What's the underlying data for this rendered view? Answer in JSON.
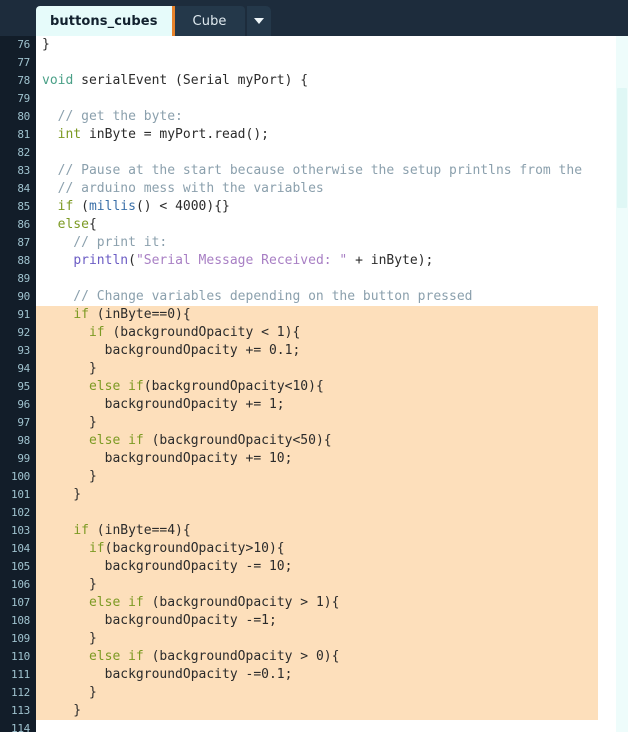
{
  "window": {
    "app": "Processing Code Editor",
    "accent_orange": "#e8832b",
    "tabbar_bg": "#1d2c3c",
    "gutter_bg": "#121d29",
    "selection_bg": "#fddfbb"
  },
  "tabs": {
    "items": [
      {
        "label": "buttons_cubes",
        "active": true
      },
      {
        "label": "Cube",
        "active": false
      }
    ],
    "menu_icon": "chevron-down-icon"
  },
  "editor": {
    "first_line": 76,
    "selection_start_line": 91,
    "selection_end_line": 113,
    "lines": [
      {
        "n": "76",
        "tokens": [
          {
            "t": "pln",
            "v": "}"
          }
        ]
      },
      {
        "n": "77",
        "tokens": []
      },
      {
        "n": "78",
        "tokens": [
          {
            "t": "typ",
            "v": "void"
          },
          {
            "t": "pln",
            "v": " serialEvent (Serial myPort) {"
          }
        ]
      },
      {
        "n": "79",
        "tokens": []
      },
      {
        "n": "80",
        "tokens": [
          {
            "t": "cmt",
            "v": "  // get the byte:"
          }
        ]
      },
      {
        "n": "81",
        "tokens": [
          {
            "t": "pln",
            "v": "  "
          },
          {
            "t": "kw",
            "v": "int"
          },
          {
            "t": "pln",
            "v": " inByte = myPort.read();"
          }
        ]
      },
      {
        "n": "82",
        "tokens": []
      },
      {
        "n": "83",
        "tokens": [
          {
            "t": "cmt",
            "v": "  // Pause at the start because otherwise the setup printlns from the"
          }
        ]
      },
      {
        "n": "84",
        "tokens": [
          {
            "t": "cmt",
            "v": "  // arduino mess with the variables"
          }
        ]
      },
      {
        "n": "85",
        "tokens": [
          {
            "t": "pln",
            "v": "  "
          },
          {
            "t": "kw",
            "v": "if"
          },
          {
            "t": "pln",
            "v": " ("
          },
          {
            "t": "fn",
            "v": "millis"
          },
          {
            "t": "pln",
            "v": "() < 4000){}"
          }
        ]
      },
      {
        "n": "86",
        "tokens": [
          {
            "t": "pln",
            "v": "  "
          },
          {
            "t": "kw",
            "v": "else"
          },
          {
            "t": "pln",
            "v": "{"
          }
        ]
      },
      {
        "n": "87",
        "tokens": [
          {
            "t": "cmt",
            "v": "    // print it:"
          }
        ]
      },
      {
        "n": "88",
        "tokens": [
          {
            "t": "pln",
            "v": "    "
          },
          {
            "t": "mth",
            "v": "println"
          },
          {
            "t": "pln",
            "v": "("
          },
          {
            "t": "str",
            "v": "\"Serial Message Received: \""
          },
          {
            "t": "pln",
            "v": " + inByte);"
          }
        ]
      },
      {
        "n": "89",
        "tokens": []
      },
      {
        "n": "90",
        "tokens": [
          {
            "t": "cmt",
            "v": "    // Change variables depending on the button pressed"
          }
        ]
      },
      {
        "n": "91",
        "tokens": [
          {
            "t": "pln",
            "v": "    "
          },
          {
            "t": "kw",
            "v": "if"
          },
          {
            "t": "pln",
            "v": " (inByte==0){"
          }
        ]
      },
      {
        "n": "92",
        "tokens": [
          {
            "t": "pln",
            "v": "      "
          },
          {
            "t": "kw",
            "v": "if"
          },
          {
            "t": "pln",
            "v": " (backgroundOpacity < 1){"
          }
        ]
      },
      {
        "n": "93",
        "tokens": [
          {
            "t": "pln",
            "v": "        backgroundOpacity += 0.1;"
          }
        ]
      },
      {
        "n": "94",
        "tokens": [
          {
            "t": "pln",
            "v": "      }"
          }
        ]
      },
      {
        "n": "95",
        "tokens": [
          {
            "t": "pln",
            "v": "      "
          },
          {
            "t": "kw",
            "v": "else if"
          },
          {
            "t": "pln",
            "v": "(backgroundOpacity<10){"
          }
        ]
      },
      {
        "n": "96",
        "tokens": [
          {
            "t": "pln",
            "v": "        backgroundOpacity += 1;"
          }
        ]
      },
      {
        "n": "97",
        "tokens": [
          {
            "t": "pln",
            "v": "      }"
          }
        ]
      },
      {
        "n": "98",
        "tokens": [
          {
            "t": "pln",
            "v": "      "
          },
          {
            "t": "kw",
            "v": "else if"
          },
          {
            "t": "pln",
            "v": " (backgroundOpacity<50){"
          }
        ]
      },
      {
        "n": "99",
        "tokens": [
          {
            "t": "pln",
            "v": "        backgroundOpacity += 10;"
          }
        ]
      },
      {
        "n": "100",
        "tokens": [
          {
            "t": "pln",
            "v": "      }"
          }
        ]
      },
      {
        "n": "101",
        "tokens": [
          {
            "t": "pln",
            "v": "    }"
          }
        ]
      },
      {
        "n": "102",
        "tokens": []
      },
      {
        "n": "103",
        "tokens": [
          {
            "t": "pln",
            "v": "    "
          },
          {
            "t": "kw",
            "v": "if"
          },
          {
            "t": "pln",
            "v": " (inByte==4){"
          }
        ]
      },
      {
        "n": "104",
        "tokens": [
          {
            "t": "pln",
            "v": "      "
          },
          {
            "t": "kw",
            "v": "if"
          },
          {
            "t": "pln",
            "v": "(backgroundOpacity>10){"
          }
        ]
      },
      {
        "n": "105",
        "tokens": [
          {
            "t": "pln",
            "v": "        backgroundOpacity -= 10;"
          }
        ]
      },
      {
        "n": "106",
        "tokens": [
          {
            "t": "pln",
            "v": "      }"
          }
        ]
      },
      {
        "n": "107",
        "tokens": [
          {
            "t": "pln",
            "v": "      "
          },
          {
            "t": "kw",
            "v": "else if"
          },
          {
            "t": "pln",
            "v": " (backgroundOpacity > 1){"
          }
        ]
      },
      {
        "n": "108",
        "tokens": [
          {
            "t": "pln",
            "v": "        backgroundOpacity -=1;"
          }
        ]
      },
      {
        "n": "109",
        "tokens": [
          {
            "t": "pln",
            "v": "      }"
          }
        ]
      },
      {
        "n": "110",
        "tokens": [
          {
            "t": "pln",
            "v": "      "
          },
          {
            "t": "kw",
            "v": "else if"
          },
          {
            "t": "pln",
            "v": " (backgroundOpacity > 0){"
          }
        ]
      },
      {
        "n": "111",
        "tokens": [
          {
            "t": "pln",
            "v": "        backgroundOpacity -=0.1;"
          }
        ]
      },
      {
        "n": "112",
        "tokens": [
          {
            "t": "pln",
            "v": "      }"
          }
        ]
      },
      {
        "n": "113",
        "tokens": [
          {
            "t": "pln",
            "v": "    }"
          }
        ]
      },
      {
        "n": "114",
        "tokens": []
      }
    ]
  },
  "scrollbar": {
    "name": "vertical-scrollbar"
  }
}
